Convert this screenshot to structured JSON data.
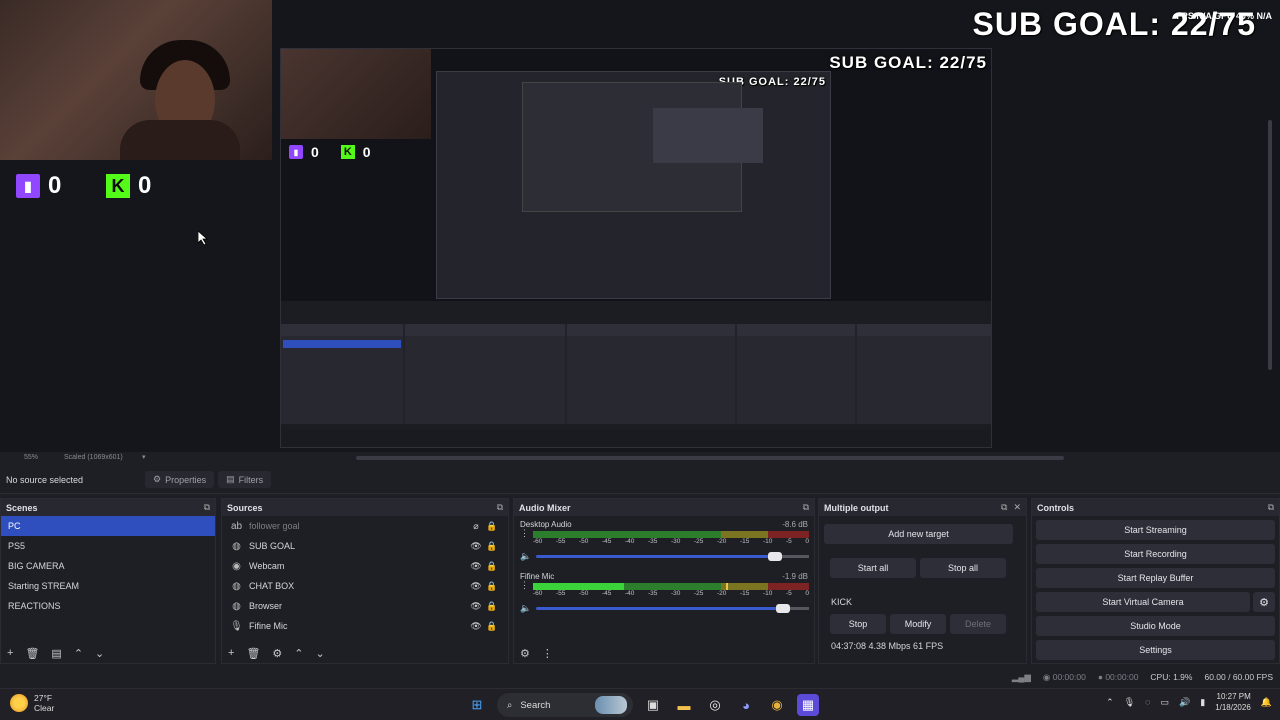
{
  "preview": {
    "sub_goal": "SUB GOAL: 22/75",
    "nested_sub_goal": "SUB GOAL: 22/75",
    "nested_sub_goal_2": "SUB GOAL: 22/75",
    "twitch_count": "0",
    "kick_count": "0",
    "kick_letter": "K",
    "stat_overlay": "FPS N/A GPU 40% N/A",
    "preview_zoom": "55%",
    "preview_scale": "Scaled (1069x601)"
  },
  "source_toolbar": {
    "no_source": "No source selected",
    "properties": "Properties",
    "filters": "Filters"
  },
  "scenes": {
    "title": "Scenes",
    "items": [
      "PC",
      "PS5",
      "BIG CAMERA",
      "Starting STREAM",
      "REACTIONS"
    ],
    "active_index": 0
  },
  "sources": {
    "title": "Sources",
    "items": [
      {
        "name": "follower goal",
        "icon": "text-icon",
        "glyph": "ab",
        "visible": false
      },
      {
        "name": "SUB GOAL",
        "icon": "globe-icon",
        "glyph": "◍",
        "visible": true
      },
      {
        "name": "Webcam",
        "icon": "camera-icon",
        "glyph": "◉",
        "visible": true
      },
      {
        "name": "CHAT BOX",
        "icon": "globe-icon",
        "glyph": "◍",
        "visible": true
      },
      {
        "name": "Browser",
        "icon": "globe-icon",
        "glyph": "◍",
        "visible": true
      },
      {
        "name": "Fifine Mic",
        "icon": "mic-icon",
        "glyph": "🎙",
        "visible": true
      }
    ]
  },
  "mixer": {
    "title": "Audio Mixer",
    "ticks": [
      "-60",
      "-55",
      "-50",
      "-45",
      "-40",
      "-35",
      "-30",
      "-25",
      "-20",
      "-15",
      "-10",
      "-5",
      "0"
    ],
    "channels": [
      {
        "name": "Desktop Audio",
        "db": "-8.6 dB",
        "level": 0,
        "volume": 0.9
      },
      {
        "name": "Fifine Mic",
        "db": "-1.9 dB",
        "level": 0.33,
        "peak": 0.7,
        "volume": 0.93
      }
    ]
  },
  "multi_output": {
    "title": "Multiple output",
    "add_target": "Add new target",
    "start_all": "Start all",
    "stop_all": "Stop all",
    "target_name": "KICK",
    "stop": "Stop",
    "modify": "Modify",
    "delete": "Delete",
    "stats": "04:37:08 4.38 Mbps 61 FPS"
  },
  "controls": {
    "title": "Controls",
    "start_streaming": "Start Streaming",
    "start_recording": "Start Recording",
    "start_replay": "Start Replay Buffer",
    "start_virtual_camera": "Start Virtual Camera",
    "studio_mode": "Studio Mode",
    "settings": "Settings"
  },
  "status": {
    "stream_time": "00:00:00",
    "rec_time": "00:00:00",
    "cpu": "CPU: 1.9%",
    "fps": "60.00 / 60.00 FPS"
  },
  "taskbar": {
    "temperature": "27°F",
    "weather": "Clear",
    "search": "Search",
    "time": "10:27 PM",
    "date": "1/18/2026"
  },
  "colors": {
    "accent": "#2f4fbf",
    "twitch": "#9146ff",
    "kick": "#53fc18"
  }
}
